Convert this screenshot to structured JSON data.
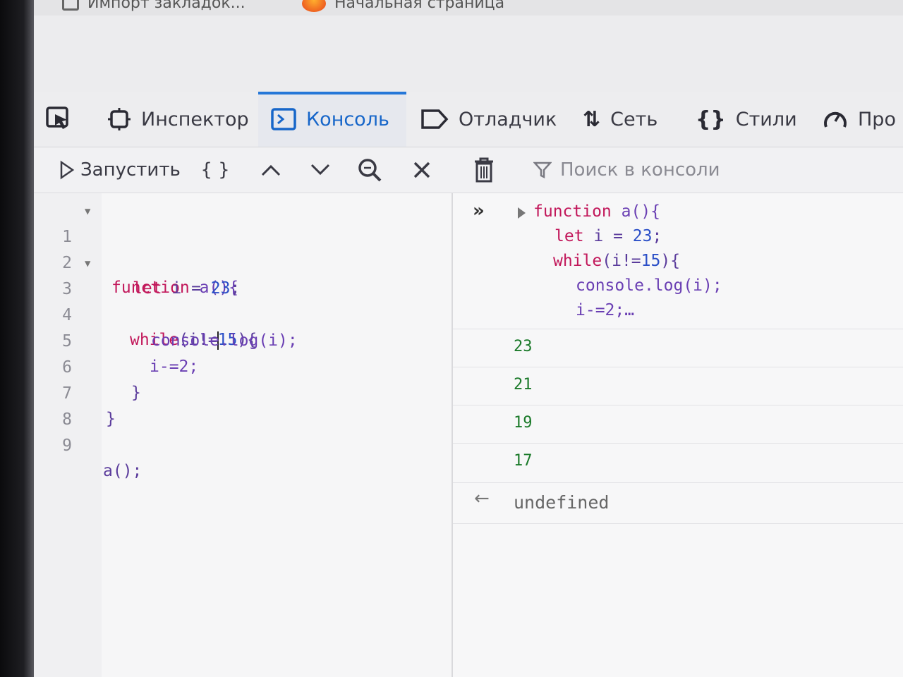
{
  "browser": {
    "bookmark_1": "Импорт закладок...",
    "bookmark_2": "Начальная страница"
  },
  "tabs": {
    "inspector": "Инспектор",
    "console": "Консоль",
    "debugger": "Отладчик",
    "network": "Сеть",
    "styles": "Стили",
    "performance": "Про"
  },
  "toolbar": {
    "run_label": "Запустить",
    "pretty_print": "{ }",
    "search_placeholder": "Поиск в консоли"
  },
  "editor": {
    "line_numbers": [
      "1",
      "2",
      "3",
      "4",
      "5",
      "6",
      "7",
      "8",
      "9"
    ],
    "l1_kw": "function",
    "l1_rest": " a(){",
    "l2_kw": "let",
    "l2_var": " i ",
    "l2_eq": "= ",
    "l2_num": "23",
    "l2_end": ";",
    "l3_kw": "while",
    "l3_a": "(i!=",
    "l3_b": "15",
    "l3_c": "){",
    "l4_a": "console",
    "l4_b": ".log(i);",
    "l5": "i-=2;",
    "l6": "}",
    "l7": "}",
    "l9": "a();"
  },
  "console": {
    "input_prompt": "»",
    "echo_l1_kw": "function",
    "echo_l1_rest": " a(){",
    "echo_l2_kw": "let",
    "echo_l2_rest": " i = ",
    "echo_l2_num": "23",
    "echo_l2_end": ";",
    "echo_l3_kw": "while",
    "echo_l3_a": "(i!=",
    "echo_l3_b": "15",
    "echo_l3_c": "){",
    "echo_l4_a": "console",
    "echo_l4_b": ".log(i);",
    "echo_l5": "i-=2;…",
    "outputs": [
      "23",
      "21",
      "19",
      "17"
    ],
    "return_arrow": "←",
    "return_value": "undefined"
  },
  "colors": {
    "accent": "#1766c9",
    "keyword": "#c2185b",
    "number": "#2b4fc7",
    "output": "#1b7a2a"
  }
}
